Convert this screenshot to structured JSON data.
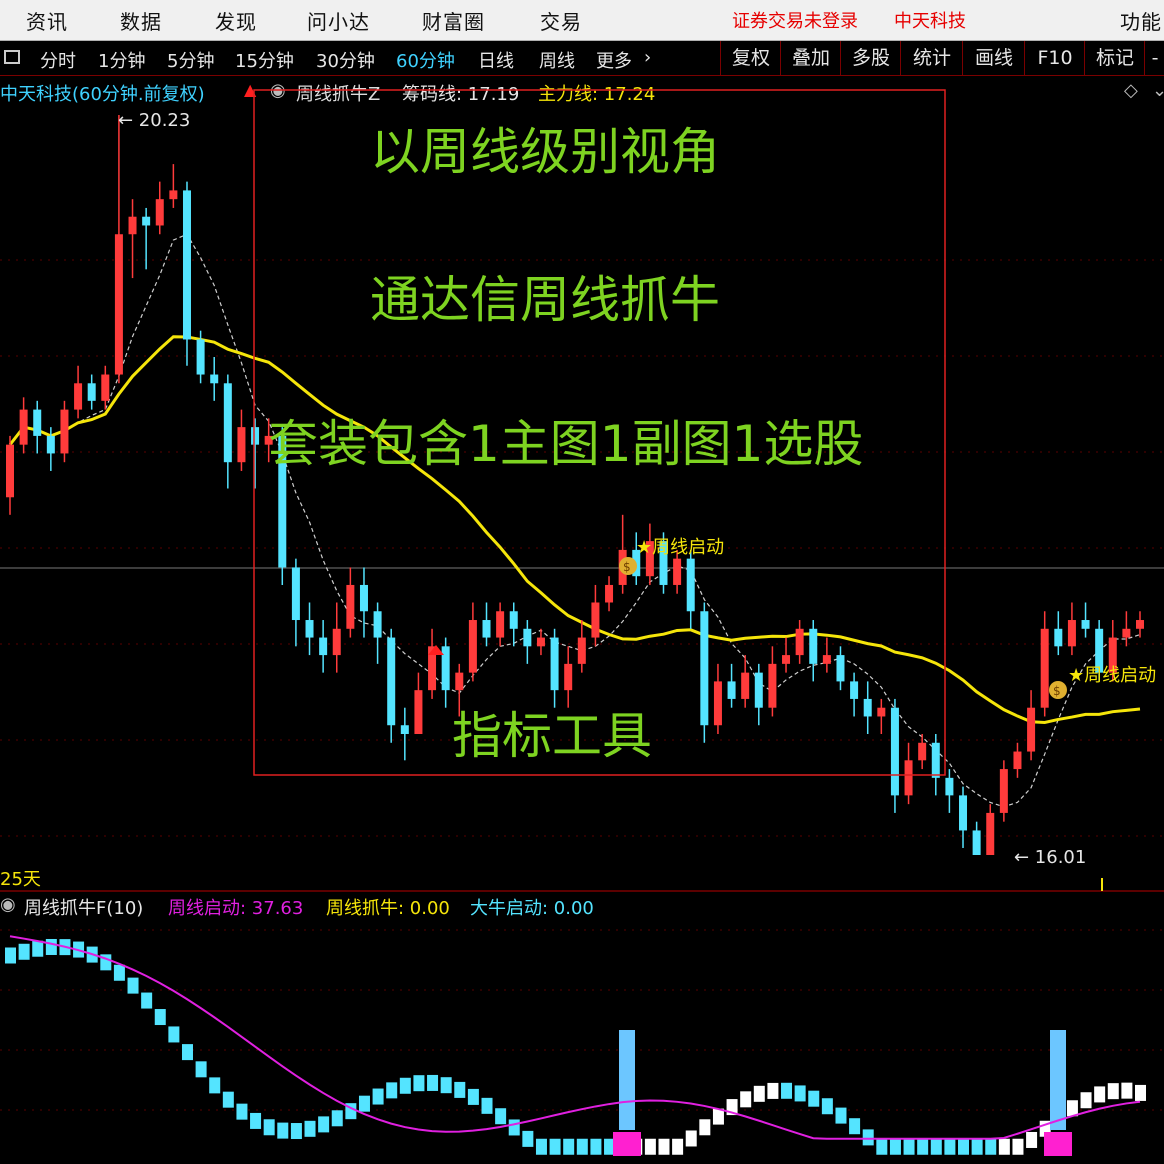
{
  "top_menu": {
    "items": [
      "资讯",
      "数据",
      "发现",
      "问小达",
      "财富圈",
      "交易"
    ],
    "login_status": "证券交易未登录",
    "stock_name": "中天科技",
    "function_label": "功能"
  },
  "period_bar": {
    "periods": [
      "分时",
      "1分钟",
      "5分钟",
      "15分钟",
      "30分钟",
      "60分钟",
      "日线",
      "周线",
      "更多"
    ],
    "active": "60分钟",
    "right_buttons": [
      "复权",
      "叠加",
      "多股",
      "统计",
      "画线",
      "F10",
      "标记"
    ]
  },
  "main_chart": {
    "title": "中天科技(60分钟.前复权)",
    "indicator_name": "周线抓牛Z",
    "chip_line_label": "筹码线: 17.19",
    "main_force_label": "主力线: 17.24",
    "high_label": "20.23",
    "low_label": "16.01",
    "signal_label": "★周线启动",
    "days_label": "25天"
  },
  "overlay": {
    "line1": "以周线级别视角",
    "line2": "通达信周线抓牛",
    "line3": "套装包含1主图1副图1选股",
    "line4": "指标工具"
  },
  "sub_chart": {
    "title": "周线抓牛F(10)",
    "startup_label": "周线启动: 37.63",
    "catch_label": "周线抓牛: 0.00",
    "bull_label": "大牛启动: 0.00"
  },
  "colors": {
    "up": "#ff3b3b",
    "down": "#54e4ff",
    "main_line": "#f5e50a",
    "chip_line": "#cfcfcf",
    "overlay_text": "#7ed321",
    "sub_magenta": "#e020e0",
    "sub_cyan": "#54e4ff"
  },
  "chart_data": {
    "type": "candlestick",
    "title": "中天科技(60分钟.前复权)",
    "y_high": 20.23,
    "y_low": 16.01,
    "candles": [
      [
        18.05,
        18.35,
        18.4,
        17.95
      ],
      [
        18.35,
        18.55,
        18.62,
        18.3
      ],
      [
        18.55,
        18.4,
        18.6,
        18.3
      ],
      [
        18.4,
        18.3,
        18.45,
        18.2
      ],
      [
        18.3,
        18.55,
        18.6,
        18.25
      ],
      [
        18.55,
        18.7,
        18.8,
        18.5
      ],
      [
        18.7,
        18.6,
        18.75,
        18.55
      ],
      [
        18.6,
        18.75,
        18.8,
        18.55
      ],
      [
        18.75,
        19.55,
        20.23,
        18.7
      ],
      [
        19.55,
        19.65,
        19.75,
        19.3
      ],
      [
        19.65,
        19.6,
        19.7,
        19.35
      ],
      [
        19.6,
        19.75,
        19.85,
        19.55
      ],
      [
        19.75,
        19.8,
        19.95,
        19.7
      ],
      [
        19.8,
        18.95,
        19.85,
        18.8
      ],
      [
        18.95,
        18.75,
        19.0,
        18.7
      ],
      [
        18.75,
        18.7,
        18.85,
        18.6
      ],
      [
        18.7,
        18.25,
        18.75,
        18.1
      ],
      [
        18.25,
        18.45,
        18.55,
        18.2
      ],
      [
        18.45,
        18.35,
        18.5,
        18.1
      ],
      [
        18.35,
        18.4,
        18.5,
        18.25
      ],
      [
        18.4,
        17.65,
        18.45,
        17.55
      ],
      [
        17.65,
        17.35,
        17.7,
        17.2
      ],
      [
        17.35,
        17.25,
        17.45,
        17.15
      ],
      [
        17.25,
        17.15,
        17.35,
        17.05
      ],
      [
        17.15,
        17.3,
        17.45,
        17.05
      ],
      [
        17.3,
        17.55,
        17.65,
        17.25
      ],
      [
        17.55,
        17.4,
        17.65,
        17.25
      ],
      [
        17.4,
        17.25,
        17.45,
        17.1
      ],
      [
        17.25,
        16.75,
        17.3,
        16.65
      ],
      [
        16.75,
        16.7,
        16.85,
        16.55
      ],
      [
        16.7,
        16.95,
        17.05,
        16.7
      ],
      [
        16.95,
        17.2,
        17.3,
        16.9
      ],
      [
        17.2,
        16.95,
        17.25,
        16.85
      ],
      [
        16.95,
        17.05,
        17.1,
        16.8
      ],
      [
        17.05,
        17.35,
        17.45,
        17.0
      ],
      [
        17.35,
        17.25,
        17.45,
        17.2
      ],
      [
        17.25,
        17.4,
        17.45,
        17.2
      ],
      [
        17.4,
        17.3,
        17.45,
        17.2
      ],
      [
        17.3,
        17.2,
        17.35,
        17.1
      ],
      [
        17.2,
        17.25,
        17.3,
        17.15
      ],
      [
        17.25,
        16.95,
        17.3,
        16.85
      ],
      [
        16.95,
        17.1,
        17.2,
        16.85
      ],
      [
        17.1,
        17.25,
        17.35,
        17.05
      ],
      [
        17.25,
        17.45,
        17.55,
        17.2
      ],
      [
        17.45,
        17.55,
        17.6,
        17.4
      ],
      [
        17.55,
        17.75,
        17.95,
        17.5
      ],
      [
        17.75,
        17.6,
        17.85,
        17.55
      ],
      [
        17.6,
        17.8,
        17.9,
        17.55
      ],
      [
        17.8,
        17.55,
        17.85,
        17.5
      ],
      [
        17.55,
        17.7,
        17.75,
        17.5
      ],
      [
        17.7,
        17.4,
        17.75,
        17.3
      ],
      [
        17.4,
        16.75,
        17.45,
        16.65
      ],
      [
        16.75,
        17.0,
        17.1,
        16.7
      ],
      [
        17.0,
        16.9,
        17.1,
        16.85
      ],
      [
        16.9,
        17.05,
        17.15,
        16.85
      ],
      [
        17.05,
        16.85,
        17.1,
        16.75
      ],
      [
        16.85,
        17.1,
        17.2,
        16.8
      ],
      [
        17.1,
        17.15,
        17.25,
        17.05
      ],
      [
        17.15,
        17.3,
        17.35,
        17.1
      ],
      [
        17.3,
        17.1,
        17.35,
        17.0
      ],
      [
        17.1,
        17.15,
        17.25,
        17.05
      ],
      [
        17.15,
        17.0,
        17.2,
        16.95
      ],
      [
        17.0,
        16.9,
        17.05,
        16.8
      ],
      [
        16.9,
        16.8,
        17.0,
        16.7
      ],
      [
        16.8,
        16.85,
        16.9,
        16.7
      ],
      [
        16.85,
        16.35,
        16.9,
        16.25
      ],
      [
        16.35,
        16.55,
        16.65,
        16.3
      ],
      [
        16.55,
        16.65,
        16.7,
        16.5
      ],
      [
        16.65,
        16.45,
        16.7,
        16.35
      ],
      [
        16.45,
        16.35,
        16.5,
        16.25
      ],
      [
        16.35,
        16.15,
        16.4,
        16.05
      ],
      [
        16.15,
        16.01,
        16.2,
        16.01
      ],
      [
        16.01,
        16.25,
        16.3,
        16.01
      ],
      [
        16.25,
        16.5,
        16.55,
        16.2
      ],
      [
        16.5,
        16.6,
        16.65,
        16.45
      ],
      [
        16.6,
        16.85,
        16.95,
        16.55
      ],
      [
        16.85,
        17.3,
        17.4,
        16.8
      ],
      [
        17.3,
        17.2,
        17.4,
        17.15
      ],
      [
        17.2,
        17.35,
        17.45,
        17.15
      ],
      [
        17.35,
        17.3,
        17.45,
        17.25
      ],
      [
        17.3,
        17.05,
        17.35,
        17.0
      ],
      [
        17.05,
        17.25,
        17.35,
        17.0
      ],
      [
        17.25,
        17.3,
        17.4,
        17.2
      ],
      [
        17.3,
        17.35,
        17.4,
        17.25
      ]
    ]
  }
}
